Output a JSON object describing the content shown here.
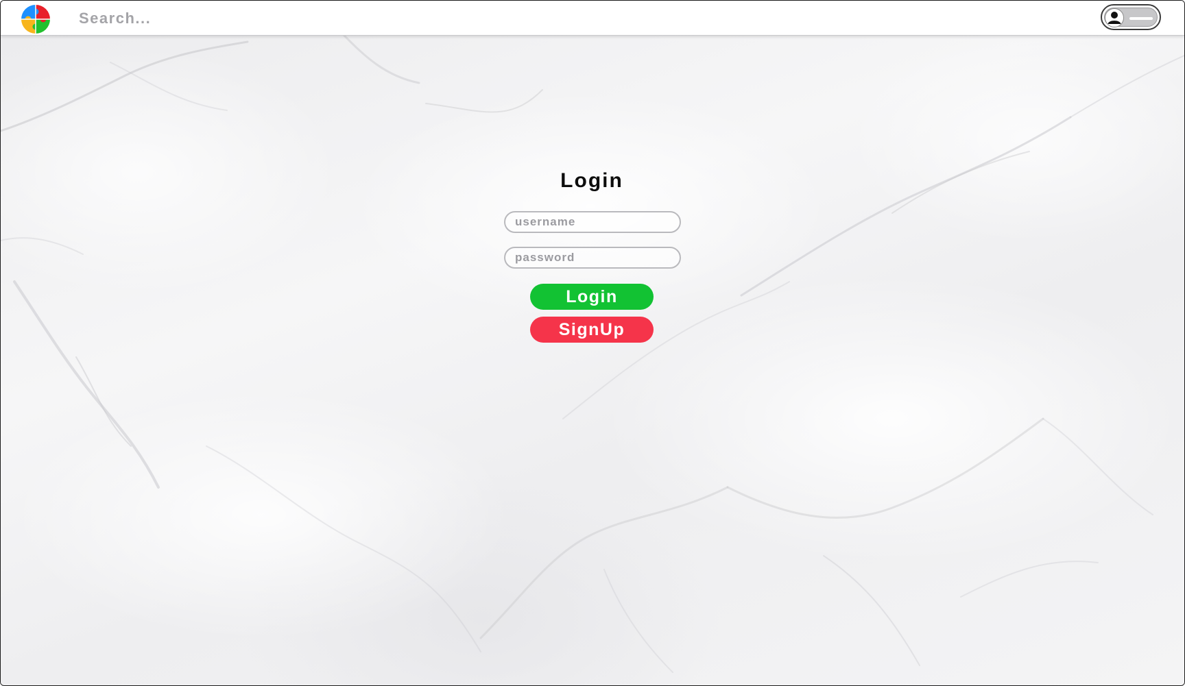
{
  "topbar": {
    "logo_icon": "puzzle-logo-icon",
    "search_placeholder": "Search...",
    "user_toggle_icon": "user-icon"
  },
  "login": {
    "title": "Login",
    "username_placeholder": "username",
    "password_placeholder": "password",
    "login_label": "Login",
    "signup_label": "SignUp"
  },
  "colors": {
    "login_button": "#12c233",
    "signup_button": "#f5344a",
    "logo_blue": "#1e90ff",
    "logo_red": "#e8202a",
    "logo_yellow": "#f7b51c",
    "logo_green": "#22c02e"
  }
}
